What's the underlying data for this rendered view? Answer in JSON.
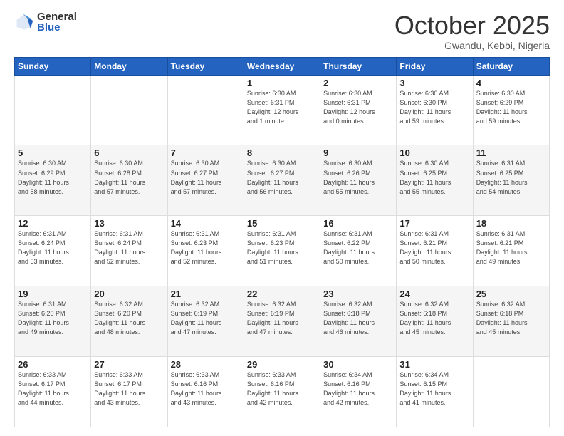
{
  "header": {
    "logo_general": "General",
    "logo_blue": "Blue",
    "month": "October 2025",
    "location": "Gwandu, Kebbi, Nigeria"
  },
  "days_of_week": [
    "Sunday",
    "Monday",
    "Tuesday",
    "Wednesday",
    "Thursday",
    "Friday",
    "Saturday"
  ],
  "weeks": [
    [
      {
        "day": "",
        "info": ""
      },
      {
        "day": "",
        "info": ""
      },
      {
        "day": "",
        "info": ""
      },
      {
        "day": "1",
        "info": "Sunrise: 6:30 AM\nSunset: 6:31 PM\nDaylight: 12 hours\nand 1 minute."
      },
      {
        "day": "2",
        "info": "Sunrise: 6:30 AM\nSunset: 6:31 PM\nDaylight: 12 hours\nand 0 minutes."
      },
      {
        "day": "3",
        "info": "Sunrise: 6:30 AM\nSunset: 6:30 PM\nDaylight: 11 hours\nand 59 minutes."
      },
      {
        "day": "4",
        "info": "Sunrise: 6:30 AM\nSunset: 6:29 PM\nDaylight: 11 hours\nand 59 minutes."
      }
    ],
    [
      {
        "day": "5",
        "info": "Sunrise: 6:30 AM\nSunset: 6:29 PM\nDaylight: 11 hours\nand 58 minutes."
      },
      {
        "day": "6",
        "info": "Sunrise: 6:30 AM\nSunset: 6:28 PM\nDaylight: 11 hours\nand 57 minutes."
      },
      {
        "day": "7",
        "info": "Sunrise: 6:30 AM\nSunset: 6:27 PM\nDaylight: 11 hours\nand 57 minutes."
      },
      {
        "day": "8",
        "info": "Sunrise: 6:30 AM\nSunset: 6:27 PM\nDaylight: 11 hours\nand 56 minutes."
      },
      {
        "day": "9",
        "info": "Sunrise: 6:30 AM\nSunset: 6:26 PM\nDaylight: 11 hours\nand 55 minutes."
      },
      {
        "day": "10",
        "info": "Sunrise: 6:30 AM\nSunset: 6:25 PM\nDaylight: 11 hours\nand 55 minutes."
      },
      {
        "day": "11",
        "info": "Sunrise: 6:31 AM\nSunset: 6:25 PM\nDaylight: 11 hours\nand 54 minutes."
      }
    ],
    [
      {
        "day": "12",
        "info": "Sunrise: 6:31 AM\nSunset: 6:24 PM\nDaylight: 11 hours\nand 53 minutes."
      },
      {
        "day": "13",
        "info": "Sunrise: 6:31 AM\nSunset: 6:24 PM\nDaylight: 11 hours\nand 52 minutes."
      },
      {
        "day": "14",
        "info": "Sunrise: 6:31 AM\nSunset: 6:23 PM\nDaylight: 11 hours\nand 52 minutes."
      },
      {
        "day": "15",
        "info": "Sunrise: 6:31 AM\nSunset: 6:23 PM\nDaylight: 11 hours\nand 51 minutes."
      },
      {
        "day": "16",
        "info": "Sunrise: 6:31 AM\nSunset: 6:22 PM\nDaylight: 11 hours\nand 50 minutes."
      },
      {
        "day": "17",
        "info": "Sunrise: 6:31 AM\nSunset: 6:21 PM\nDaylight: 11 hours\nand 50 minutes."
      },
      {
        "day": "18",
        "info": "Sunrise: 6:31 AM\nSunset: 6:21 PM\nDaylight: 11 hours\nand 49 minutes."
      }
    ],
    [
      {
        "day": "19",
        "info": "Sunrise: 6:31 AM\nSunset: 6:20 PM\nDaylight: 11 hours\nand 49 minutes."
      },
      {
        "day": "20",
        "info": "Sunrise: 6:32 AM\nSunset: 6:20 PM\nDaylight: 11 hours\nand 48 minutes."
      },
      {
        "day": "21",
        "info": "Sunrise: 6:32 AM\nSunset: 6:19 PM\nDaylight: 11 hours\nand 47 minutes."
      },
      {
        "day": "22",
        "info": "Sunrise: 6:32 AM\nSunset: 6:19 PM\nDaylight: 11 hours\nand 47 minutes."
      },
      {
        "day": "23",
        "info": "Sunrise: 6:32 AM\nSunset: 6:18 PM\nDaylight: 11 hours\nand 46 minutes."
      },
      {
        "day": "24",
        "info": "Sunrise: 6:32 AM\nSunset: 6:18 PM\nDaylight: 11 hours\nand 45 minutes."
      },
      {
        "day": "25",
        "info": "Sunrise: 6:32 AM\nSunset: 6:18 PM\nDaylight: 11 hours\nand 45 minutes."
      }
    ],
    [
      {
        "day": "26",
        "info": "Sunrise: 6:33 AM\nSunset: 6:17 PM\nDaylight: 11 hours\nand 44 minutes."
      },
      {
        "day": "27",
        "info": "Sunrise: 6:33 AM\nSunset: 6:17 PM\nDaylight: 11 hours\nand 43 minutes."
      },
      {
        "day": "28",
        "info": "Sunrise: 6:33 AM\nSunset: 6:16 PM\nDaylight: 11 hours\nand 43 minutes."
      },
      {
        "day": "29",
        "info": "Sunrise: 6:33 AM\nSunset: 6:16 PM\nDaylight: 11 hours\nand 42 minutes."
      },
      {
        "day": "30",
        "info": "Sunrise: 6:34 AM\nSunset: 6:16 PM\nDaylight: 11 hours\nand 42 minutes."
      },
      {
        "day": "31",
        "info": "Sunrise: 6:34 AM\nSunset: 6:15 PM\nDaylight: 11 hours\nand 41 minutes."
      },
      {
        "day": "",
        "info": ""
      }
    ]
  ]
}
